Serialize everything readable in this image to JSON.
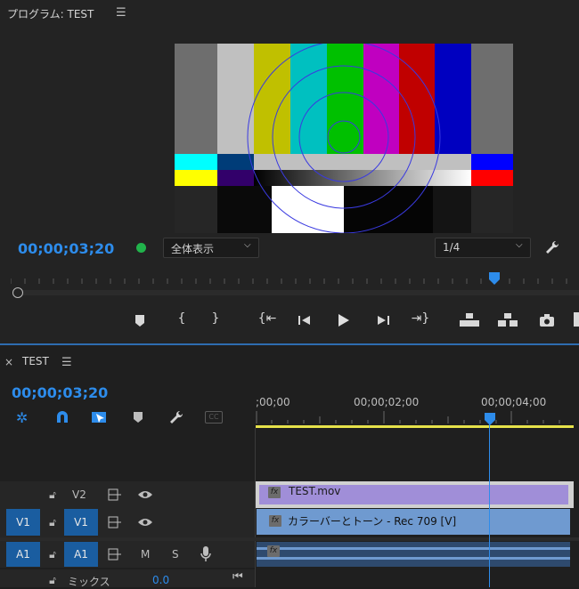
{
  "program": {
    "title": "プログラム: TEST",
    "timecode": "00;00;03;20",
    "zoom_select": "全体表示",
    "resolution_select": "1/4"
  },
  "timeline": {
    "sequence_tab": "TEST",
    "timecode": "00;00;03;20",
    "ruler_labels": [
      ";00;00",
      "00;00;02;00",
      "00;00;04;00"
    ],
    "tracks": {
      "v2": {
        "label": "V2"
      },
      "v1": {
        "source": "V1",
        "label": "V1"
      },
      "a1": {
        "source": "A1",
        "label": "A1",
        "mute": "M",
        "solo": "S"
      },
      "mix": {
        "label": "ミックス",
        "value": "0.0"
      }
    },
    "clips": {
      "v2_clip": "TEST.mov",
      "v1_clip": "カラーバーとトーン - Rec 709 [V]",
      "fx": "fx"
    },
    "cc_label": "CC"
  },
  "colors": {
    "accent": "#2d8ceb",
    "v2_clip": "#a08ed8",
    "v1_clip": "#6f9ad0",
    "a1_clip": "#6f9ad0",
    "work_area": "#e6e24a"
  }
}
